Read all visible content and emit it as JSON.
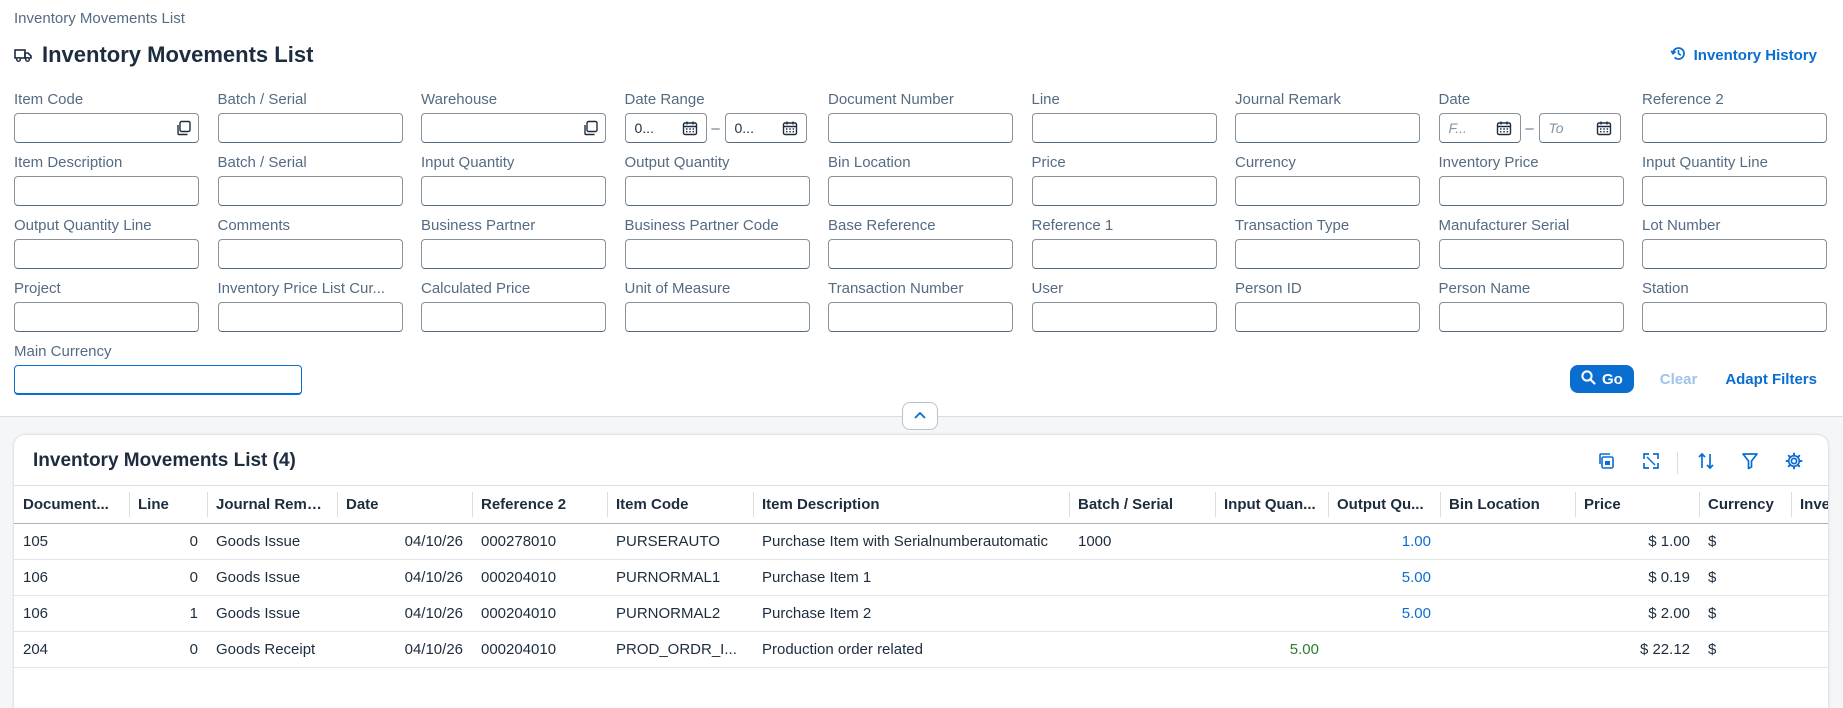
{
  "breadcrumb": "Inventory Movements List",
  "page_title": "Inventory Movements List",
  "history_link": "Inventory History",
  "filters": [
    {
      "label": "Item Code",
      "type": "valuehelp"
    },
    {
      "label": "Batch / Serial",
      "type": "text"
    },
    {
      "label": "Warehouse",
      "type": "valuehelp"
    },
    {
      "label": "Date Range",
      "type": "daterange",
      "from": "0...",
      "to": "0..."
    },
    {
      "label": "Document Number",
      "type": "text"
    },
    {
      "label": "Line",
      "type": "text"
    },
    {
      "label": "Journal Remark",
      "type": "text"
    },
    {
      "label": "Date",
      "type": "daterange",
      "from_placeholder": "F...",
      "to_placeholder": "To"
    },
    {
      "label": "Reference 2",
      "type": "text"
    },
    {
      "label": "Item Description",
      "type": "text"
    },
    {
      "label": "Batch / Serial",
      "type": "text"
    },
    {
      "label": "Input Quantity",
      "type": "text"
    },
    {
      "label": "Output Quantity",
      "type": "text"
    },
    {
      "label": "Bin Location",
      "type": "text"
    },
    {
      "label": "Price",
      "type": "text"
    },
    {
      "label": "Currency",
      "type": "text"
    },
    {
      "label": "Inventory Price",
      "type": "text"
    },
    {
      "label": "Input Quantity Line",
      "type": "text"
    },
    {
      "label": "Output Quantity Line",
      "type": "text"
    },
    {
      "label": "Comments",
      "type": "text"
    },
    {
      "label": "Business Partner",
      "type": "text"
    },
    {
      "label": "Business Partner Code",
      "type": "text"
    },
    {
      "label": "Base Reference",
      "type": "text"
    },
    {
      "label": "Reference 1",
      "type": "text"
    },
    {
      "label": "Transaction Type",
      "type": "text"
    },
    {
      "label": "Manufacturer Serial",
      "type": "text"
    },
    {
      "label": "Lot Number",
      "type": "text"
    },
    {
      "label": "Project",
      "type": "text"
    },
    {
      "label": "Inventory Price List Cur...",
      "type": "text"
    },
    {
      "label": "Calculated Price",
      "type": "text"
    },
    {
      "label": "Unit of Measure",
      "type": "text"
    },
    {
      "label": "Transaction Number",
      "type": "text"
    },
    {
      "label": "User",
      "type": "text"
    },
    {
      "label": "Person ID",
      "type": "text"
    },
    {
      "label": "Person Name",
      "type": "text"
    },
    {
      "label": "Station",
      "type": "text"
    }
  ],
  "main_currency": {
    "label": "Main Currency",
    "value": ""
  },
  "actions": {
    "go": "Go",
    "clear": "Clear",
    "adapt": "Adapt Filters"
  },
  "table": {
    "title": "Inventory Movements List (4)",
    "columns": [
      "Document...",
      "Line",
      "Journal Remark",
      "Date",
      "Reference 2",
      "Item Code",
      "Item Description",
      "Batch / Serial",
      "Input Quan...",
      "Output Qu...",
      "Bin Location",
      "Price",
      "Currency",
      "Inve"
    ],
    "rows": [
      [
        "105",
        "0",
        "Goods Issue",
        "04/10/26",
        "000278010",
        "PURSERAUTO",
        "Purchase Item with Serialnumberautomatic",
        "1000",
        "",
        "1.00",
        "",
        "$ 1.00",
        "$",
        ""
      ],
      [
        "106",
        "0",
        "Goods Issue",
        "04/10/26",
        "000204010",
        "PURNORMAL1",
        "Purchase Item 1",
        "",
        "",
        "5.00",
        "",
        "$ 0.19",
        "$",
        ""
      ],
      [
        "106",
        "1",
        "Goods Issue",
        "04/10/26",
        "000204010",
        "PURNORMAL2",
        "Purchase Item 2",
        "",
        "",
        "5.00",
        "",
        "$ 2.00",
        "$",
        ""
      ],
      [
        "204",
        "0",
        "Goods Receipt",
        "04/10/26",
        "000204010",
        "PROD_ORDR_I...",
        "Production order related",
        "",
        "5.00",
        "",
        "",
        "$ 22.12",
        "$",
        ""
      ]
    ]
  },
  "colors": {
    "accent": "#0a6ed1",
    "text": "#1d2d3e",
    "label": "#556b82",
    "positive": "#2b7c2b"
  }
}
